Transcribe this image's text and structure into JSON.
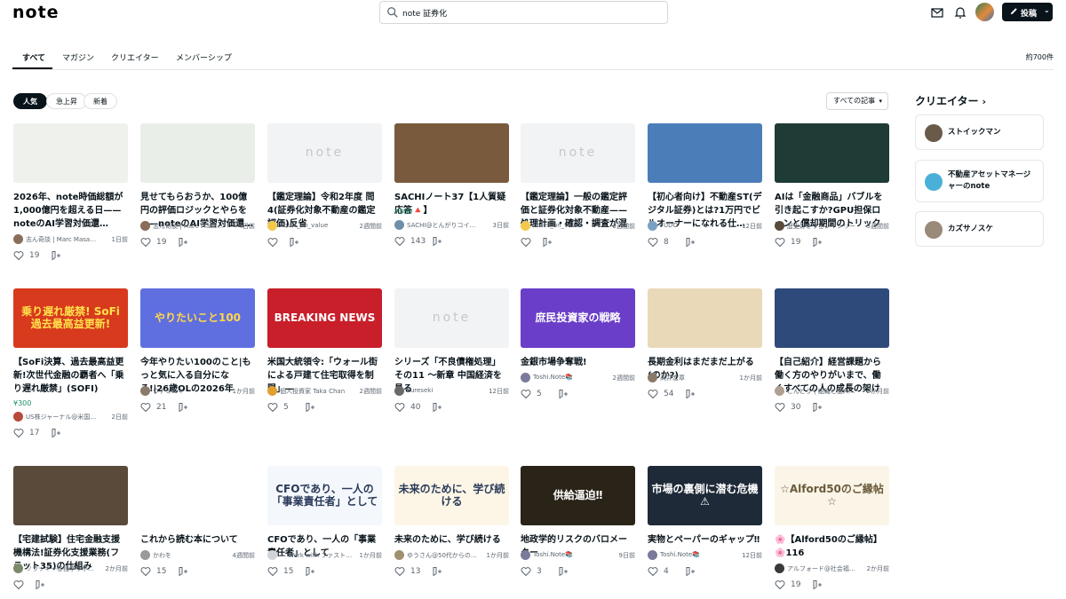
{
  "header": {
    "logo": "note",
    "search_value": "note 証券化",
    "post_label": "投稿",
    "icons": [
      "mail-icon",
      "bell-icon"
    ]
  },
  "tabs": [
    {
      "label": "すべて",
      "active": true
    },
    {
      "label": "マガジン",
      "active": false
    },
    {
      "label": "クリエイター",
      "active": false
    },
    {
      "label": "メンバーシップ",
      "active": false
    }
  ],
  "result_count": "約700件",
  "filters": {
    "chips": [
      {
        "label": "人気",
        "active": true
      },
      {
        "label": "急上昇",
        "active": false
      },
      {
        "label": "新着",
        "active": false
      }
    ],
    "sort": "すべての記事"
  },
  "cards": [
    {
      "thumb_text": "",
      "thumb_bg": "#eef1ec",
      "thumb_fg": "#4a6e8a",
      "title": "2026年、note時価総額が1,000億円を超える日——noteのAI学習対価還…",
      "price": "",
      "author": "志ん奇談 | Marc Masahir…",
      "time": "1日前",
      "likes": "19",
      "avatar": "#8a6d5a"
    },
    {
      "thumb_text": "",
      "thumb_bg": "#eaeee8",
      "thumb_fg": "#4a6e8a",
      "title": "見せてもらおうか、100億円の評価ロジックとやらを——noteのAI学習対価還…",
      "price": "",
      "author": "志ん奇談 | Marc Masahir…",
      "time": "4日前",
      "likes": "19",
      "avatar": "#8a6d5a"
    },
    {
      "thumb_text": "note",
      "thumb_bg": "#f2f3f4",
      "thumb_fg": "#c4c8cc",
      "title": "【鑑定理論】令和2年度 問4(証券化対象不動産の鑑定評価)反省",
      "price": "",
      "author": "notes_on_value",
      "time": "2週間前",
      "likes": "",
      "avatar": "#f2c94c"
    },
    {
      "thumb_text": "",
      "thumb_bg": "#7a5a3c",
      "thumb_fg": "#fff",
      "title": "SACHIノート37【1人質疑応答🔺】",
      "price": "¥500",
      "author": "SACHI@とんがりコイナ…",
      "time": "3日前",
      "likes": "143",
      "avatar": "#6f8fa8"
    },
    {
      "thumb_text": "note",
      "thumb_bg": "#f2f3f4",
      "thumb_fg": "#c4c8cc",
      "title": "【鑑定理論】一般の鑑定評価と証券化対象不動産——処理計画・確認・調査が混乱…",
      "price": "",
      "author": "notes_on_value",
      "time": "3週間前",
      "likes": "",
      "avatar": "#f2c94c"
    },
    {
      "thumb_text": "",
      "thumb_bg": "#4b7db8",
      "thumb_fg": "#fff",
      "title": "【初心者向け】不動産ST(デジタル証券)とは?1万円でビルオーナーになれる仕…",
      "price": "",
      "author": "FUDO",
      "time": "12日前",
      "likes": "8",
      "avatar": "#7aa0c4"
    },
    {
      "thumb_text": "",
      "thumb_bg": "#1e3b35",
      "thumb_fg": "#f0c060",
      "title": "AIは「金融商品」バブルを引き起こすか?GPU担保ローンと償却期間のトリック",
      "price": "",
      "author": "歴史好きウェンヤンリー",
      "time": "3週間前",
      "likes": "19",
      "avatar": "#5a4a3a"
    },
    {
      "thumb_text": "乗り遅れ厳禁! SoFi過去最高益更新!",
      "thumb_bg": "#d83a1e",
      "thumb_fg": "#ffe14a",
      "title": "【SoFi決算、過去最高益更新!次世代金融の覇者へ「乗り遅れ厳禁」(SOFI) SoF…",
      "price": "¥300",
      "author": "US株ジャーナル@米国…",
      "time": "2日前",
      "likes": "17",
      "avatar": "#b84a3a"
    },
    {
      "thumb_text": "やりたいこと100",
      "thumb_bg": "#5f6fe0",
      "thumb_fg": "#ffd84a",
      "title": "今年やりたい100のこと|もっと気に入る自分になる!|26歳OLの2026年",
      "price": "",
      "author": "ウナミユキ",
      "time": "1か月前",
      "likes": "21",
      "avatar": "#8a7a6a"
    },
    {
      "thumb_text": "BREAKING NEWS",
      "thumb_bg": "#c81f2a",
      "thumb_fg": "#ffffff",
      "title": "米国大統領令:「ウォール街による戸建て住宅取得を制限」—",
      "price": "",
      "author": "個人投資家 Taka Chan",
      "time": "2週間前",
      "likes": "5",
      "avatar": "#e0a030"
    },
    {
      "thumb_text": "note",
      "thumb_bg": "#f2f3f4",
      "thumb_fg": "#c4c8cc",
      "title": "シリーズ「不良債権処理」その11 〜新章 中国経済を見る",
      "price": "",
      "author": "kureseki",
      "time": "12日前",
      "likes": "40",
      "avatar": "#6a6a6a"
    },
    {
      "thumb_text": "庶民投資家の戦略",
      "thumb_bg": "#6a3ec8",
      "thumb_fg": "#ffffff",
      "title": "金銀市場争奪戦!",
      "price": "",
      "author": "Toshi.Note📚",
      "time": "2週間前",
      "likes": "5",
      "avatar": "#7a7a9a"
    },
    {
      "thumb_text": "",
      "thumb_bg": "#e9d9b8",
      "thumb_fg": "#8a6a2a",
      "title": "長期金利はまだまだ上がる(のか?)",
      "price": "",
      "author": "高井宏章",
      "time": "1か月前",
      "likes": "54",
      "avatar": "#8a7a6a"
    },
    {
      "thumb_text": "",
      "thumb_bg": "#2e4a7a",
      "thumb_fg": "#f0c060",
      "title": "【自己紹介】経営課題から働く方のやりがいまで、働くすべての人の成長の架け橋…",
      "price": "",
      "author": "こんどう | 組織と個人…",
      "time": "2か月前",
      "likes": "30",
      "avatar": "#b0a090"
    },
    {
      "thumb_text": "",
      "thumb_bg": "#5a4a3a",
      "thumb_fg": "#f0d090",
      "title": "【宅建試験】住宅金融支援機構法!証券化支援業務(フラット35)の仕組み",
      "price": "",
      "author": "ソラッキー@独学サポ…",
      "time": "2か月前",
      "likes": "",
      "avatar": "#7a8a6a"
    },
    {
      "thumb_text": "",
      "thumb_bg": "#ffffff",
      "thumb_fg": "#8a7a5a",
      "title": "これから読む本について",
      "price": "",
      "author": "かわを",
      "time": "4週間前",
      "likes": "15",
      "avatar": "#9a9a9a"
    },
    {
      "thumb_text": "CFOであり、一人の「事業責任者」として",
      "thumb_bg": "#f4f8fc",
      "thumb_fg": "#2a3a5a",
      "title": "CFOであり、一人の「事業責任者」として",
      "price": "",
      "author": "— Work with ファストド…",
      "time": "1か月前",
      "likes": "15",
      "avatar": "#d0d4d8"
    },
    {
      "thumb_text": "未来のために、学び続ける",
      "thumb_bg": "#fdf6e6",
      "thumb_fg": "#2a3a5a",
      "title": "未来のために、学び続ける",
      "price": "",
      "author": "ゆうさん@50代からの…",
      "time": "1か月前",
      "likes": "13",
      "avatar": "#a09070"
    },
    {
      "thumb_text": "供給逼迫‼",
      "thumb_bg": "#2a2418",
      "thumb_fg": "#ffffff",
      "title": "地政学的リスクのバロメーター",
      "price": "",
      "author": "Toshi.Note📚",
      "time": "9日前",
      "likes": "3",
      "avatar": "#7a7a9a"
    },
    {
      "thumb_text": "市場の裏側に潜む危機⚠",
      "thumb_bg": "#1e2a38",
      "thumb_fg": "#ffffff",
      "title": "実物とペーパーのギャップ‼",
      "price": "",
      "author": "Toshi.Note📚",
      "time": "12日前",
      "likes": "4",
      "avatar": "#7a7a9a"
    },
    {
      "thumb_text": "☆Alford50のご縁帖☆",
      "thumb_bg": "#fbf5e8",
      "thumb_fg": "#6a5a3a",
      "title": "🌸【Alford50のご縁帖】🌸116",
      "price": "",
      "author": "アルフォード@社会福…",
      "time": "2か月前",
      "likes": "19",
      "avatar": "#3a3a3a"
    }
  ],
  "sidebar": {
    "title": "クリエイター",
    "creators": [
      {
        "name": "ストイックマン",
        "avatar": "#6a5a4a"
      },
      {
        "name": "不動産アセットマネージャーのnote",
        "avatar": "#4ab0d8"
      },
      {
        "name": "カズサノスケ",
        "avatar": "#9a8a7a"
      }
    ]
  }
}
